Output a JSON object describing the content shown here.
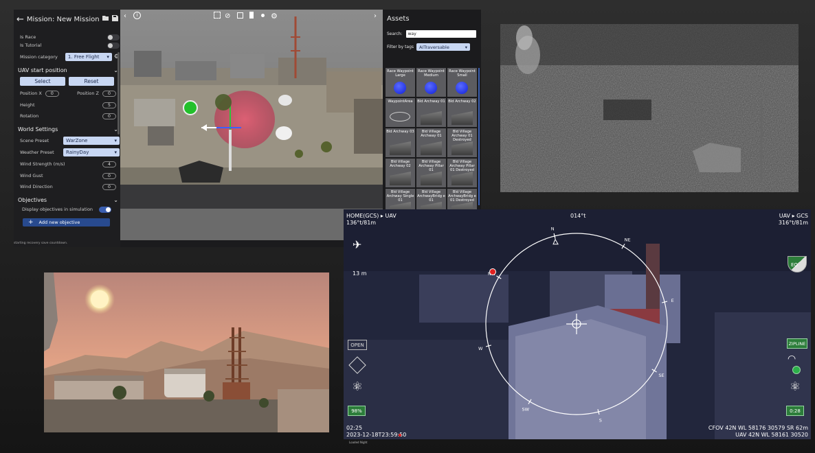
{
  "editor": {
    "title": "Mission: New Mission",
    "rows": {
      "is_race": "Is Race",
      "is_tutorial": "Is Tutorial",
      "mission_category_label": "Mission category",
      "mission_category_value": "1. Free Flight"
    },
    "uav_start": {
      "heading": "UAV start position",
      "select_label": "Select",
      "reset_label": "Reset",
      "position_x_label": "Position X",
      "position_x_value": "0",
      "position_z_label": "Position Z",
      "position_z_value": "0",
      "height_label": "Height",
      "height_value": "5",
      "rotation_label": "Rotation",
      "rotation_value": "0"
    },
    "world": {
      "heading": "World Settings",
      "scene_preset_label": "Scene Preset",
      "scene_preset_value": "WarZone",
      "weather_preset_label": "Weather Preset",
      "weather_preset_value": "RainyDay",
      "wind_strength_label": "Wind Strength (m/s)",
      "wind_strength_value": "4",
      "wind_gust_label": "Wind Gust",
      "wind_gust_value": "0",
      "wind_direction_label": "Wind Direction",
      "wind_direction_value": "0"
    },
    "objectives": {
      "heading": "Objectives",
      "display_label": "Display objectives in simulation",
      "add_label": "Add new objective"
    },
    "status": "starting recovery save countdown."
  },
  "assets": {
    "title": "Assets",
    "search_label": "Search:",
    "search_value": "way",
    "filter_label": "Filter by tags",
    "filter_value": "AITraversable",
    "tiles": [
      {
        "label": "Race Waypoint Large",
        "kind": "ball"
      },
      {
        "label": "Race Waypoint Medium",
        "kind": "ball"
      },
      {
        "label": "Race Waypoint Small",
        "kind": "ball"
      },
      {
        "label": "WaypointArea",
        "kind": "area"
      },
      {
        "label": "Bld Archway 01",
        "kind": "arch"
      },
      {
        "label": "Bld Archway 02",
        "kind": "arch"
      },
      {
        "label": "Bld Archway 03",
        "kind": "arch"
      },
      {
        "label": "Bld Village Archway 01",
        "kind": "arch"
      },
      {
        "label": "Bld Village Archway 01 Destroyed",
        "kind": "arch"
      },
      {
        "label": "Bld Village Archway 02",
        "kind": "arch"
      },
      {
        "label": "Bld Village Archway Pillar 01",
        "kind": "arch"
      },
      {
        "label": "Bld Village Archway Pillar 01 Destroyed",
        "kind": "arch"
      },
      {
        "label": "Bld Village Archway Single 01",
        "kind": "arch"
      },
      {
        "label": "Bld Village ArchwayBridg e 01",
        "kind": "arch"
      },
      {
        "label": "Bld Village ArchwayBridg e 01 Destroyed",
        "kind": "arch"
      }
    ]
  },
  "hud": {
    "home_label": "HOME(GCS) ▸ UAV",
    "home_value": "136°t/81m",
    "heading": "014°t",
    "uav_gcs_label": "UAV ▸ GCS",
    "uav_gcs_value": "316°t/81m",
    "altitude": "13 m",
    "open_label": "OPEN",
    "zipline_label": "ZIPLINE",
    "eo_label": "EO",
    "battery": "98%",
    "timer": "0:28",
    "left_counter": "2",
    "right_counter": "1",
    "compass": [
      "N",
      "NE",
      "E",
      "SE",
      "S",
      "SW",
      "W",
      "NW"
    ],
    "time": "02:25",
    "datetime": "2023-12-18T23:59:50",
    "cfov": "CFOV 42N WL 58176 30579 SR 62m",
    "uav_pos": "UAV 42N WL 58161 30520",
    "footer": "Loaded Night"
  },
  "colors": {
    "accent_blue": "#3b5fb0",
    "select_bg": "#c8d7f3",
    "hud_green": "#2c7d3a",
    "rec_red": "#e02020"
  }
}
